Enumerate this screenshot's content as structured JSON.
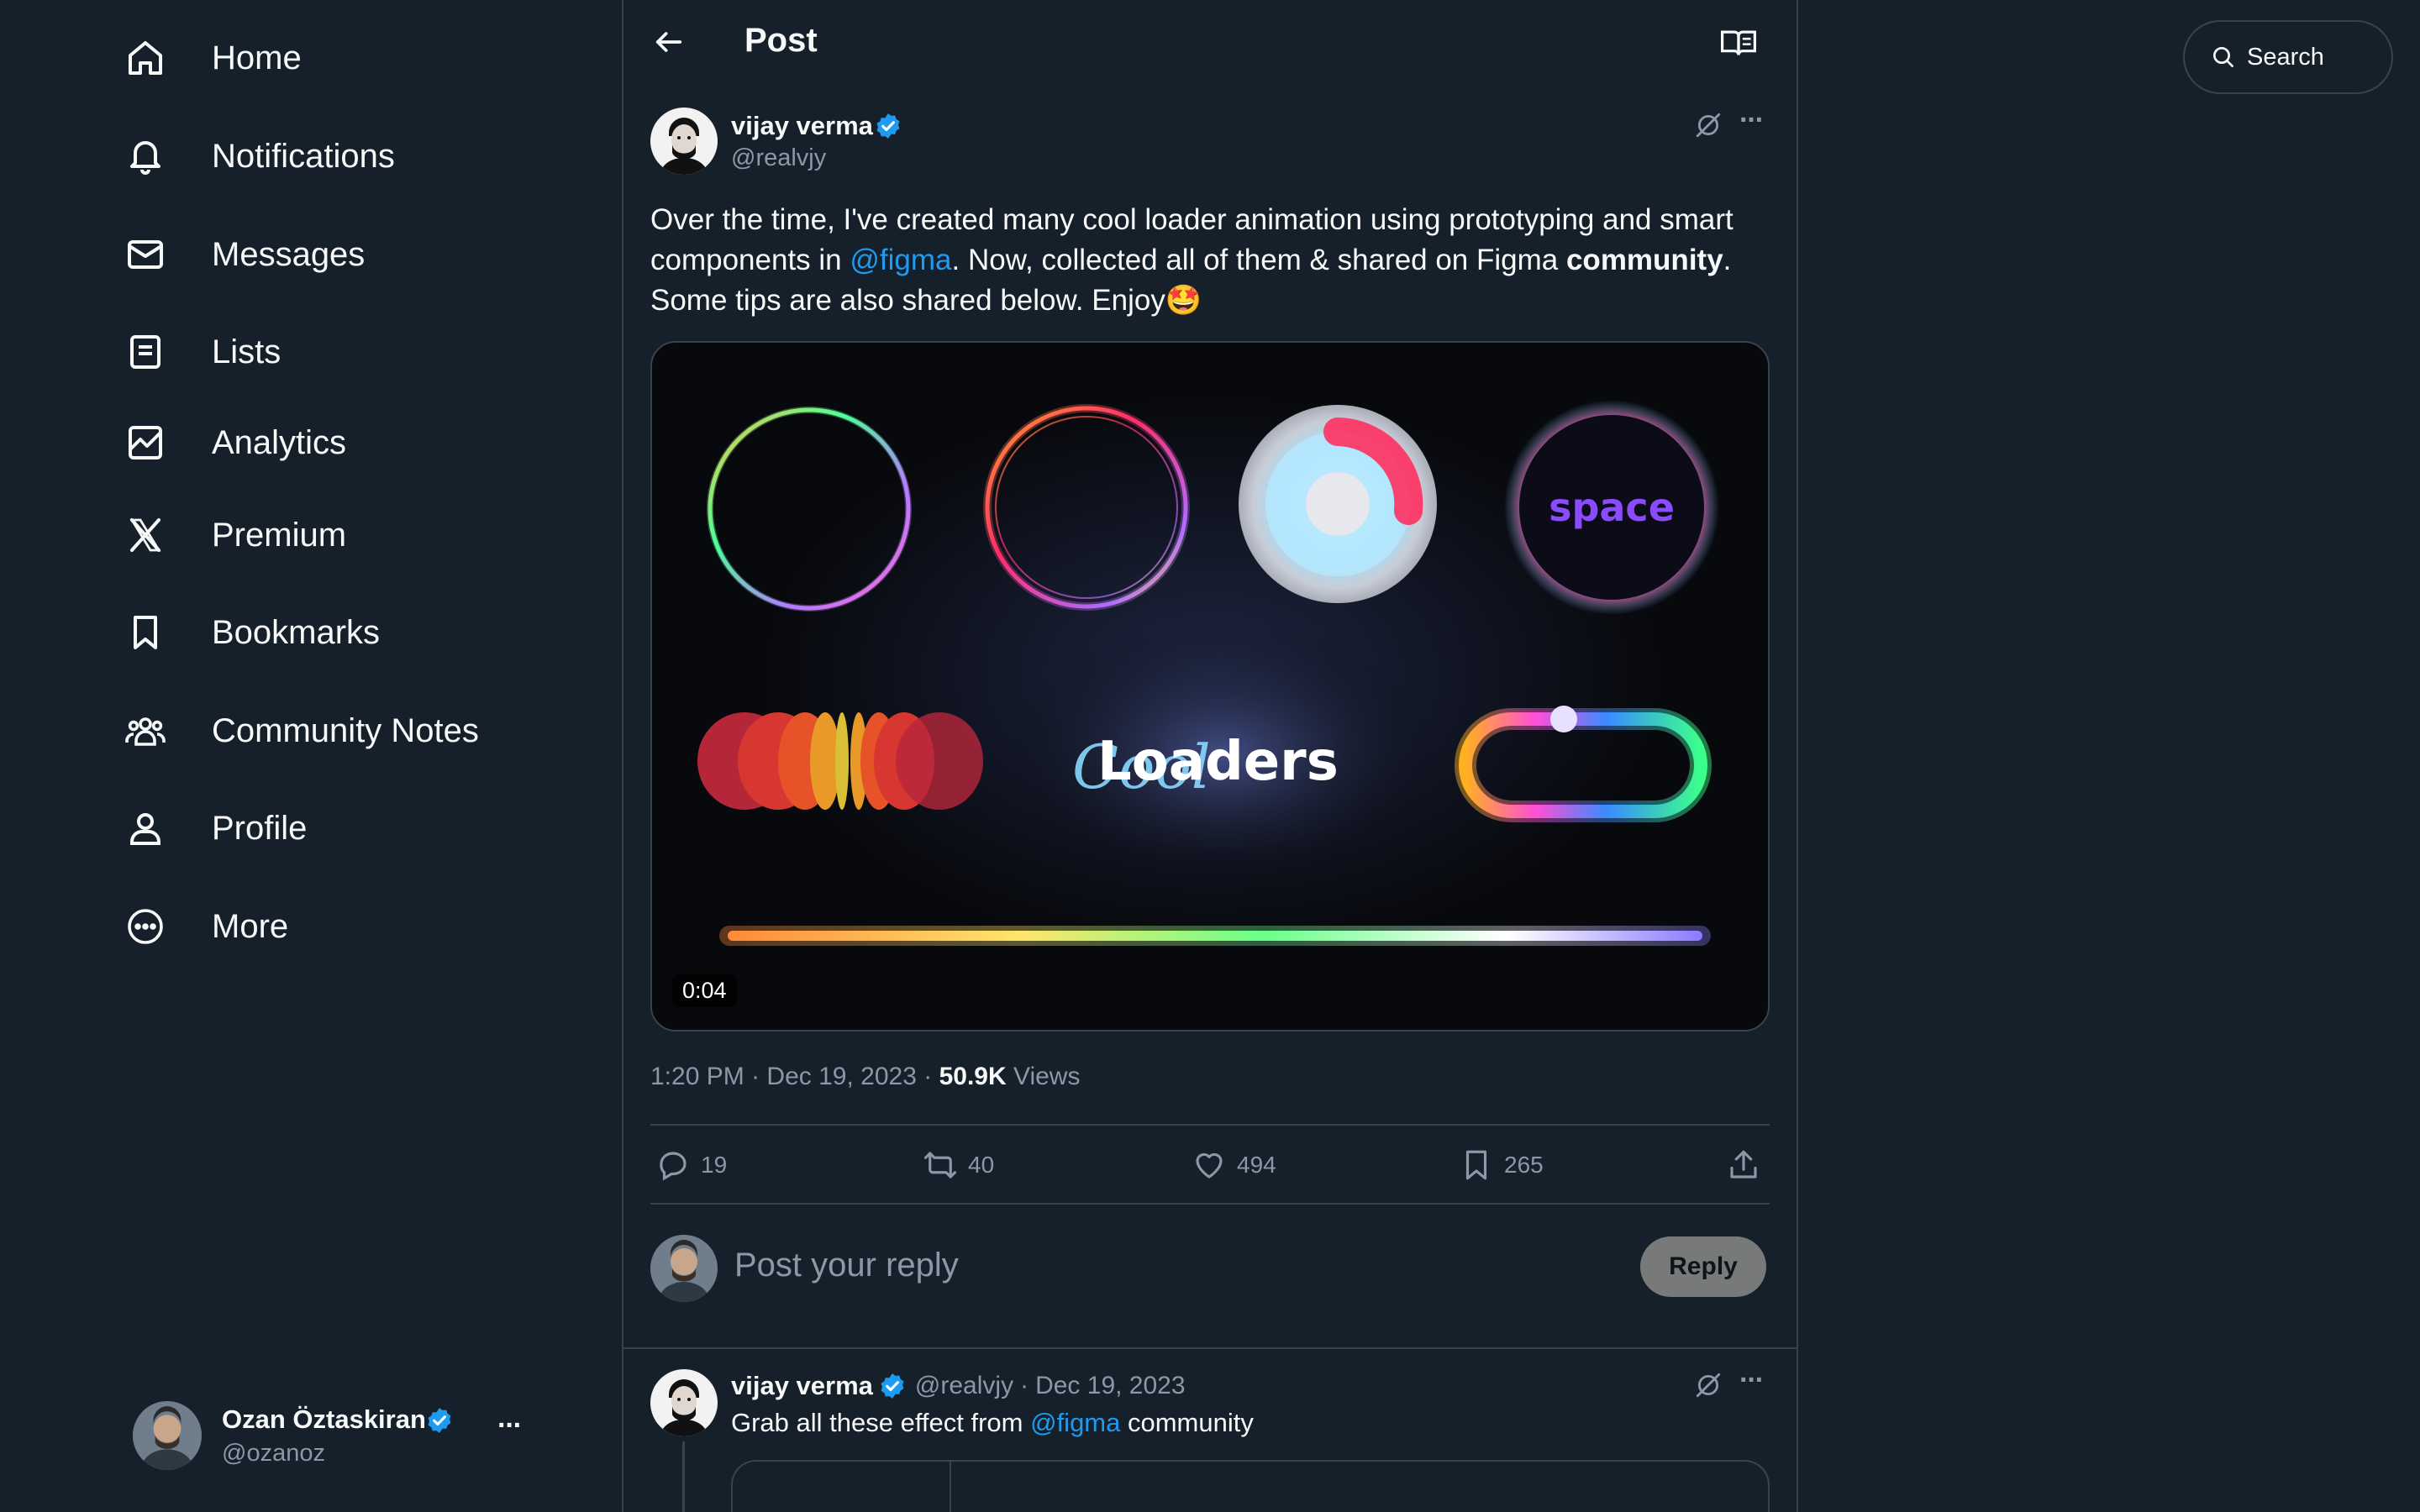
{
  "sidebar": {
    "items": [
      {
        "label": "Home",
        "icon": "home-icon"
      },
      {
        "label": "Notifications",
        "icon": "bell-icon"
      },
      {
        "label": "Messages",
        "icon": "envelope-icon"
      },
      {
        "label": "Lists",
        "icon": "list-icon"
      },
      {
        "label": "Analytics",
        "icon": "analytics-icon"
      },
      {
        "label": "Premium",
        "icon": "x-logo-icon"
      },
      {
        "label": "Bookmarks",
        "icon": "bookmark-icon"
      },
      {
        "label": "Community Notes",
        "icon": "people-icon"
      },
      {
        "label": "Profile",
        "icon": "person-icon"
      },
      {
        "label": "More",
        "icon": "more-circle-icon"
      }
    ],
    "account": {
      "name": "Ozan Öztaskiran",
      "handle": "@ozanoz",
      "more": "···"
    }
  },
  "header": {
    "title": "Post"
  },
  "post": {
    "author": {
      "name": "vijay verma",
      "handle": "@realvjy"
    },
    "text": {
      "line1": "Over the time, I've created many cool loader animation using prototyping and smart",
      "line2_pre": "components in ",
      "mention": "@figma",
      "line2_mid": ". Now, collected all of them & shared on Figma ",
      "line2_bold": "community",
      "line2_end": ".",
      "line3": "Some tips are also shared below. Enjoy🤩"
    },
    "media": {
      "duration": "0:04",
      "space_text": "space",
      "cool_text": "Cool",
      "loaders_text": "Loaders"
    },
    "meta": {
      "time": "1:20 PM",
      "date": "Dec 19, 2023",
      "views": "50.9K",
      "views_label": "Views",
      "sep": "·"
    },
    "actions": {
      "replies": "19",
      "reposts": "40",
      "likes": "494",
      "bookmarks": "265"
    }
  },
  "compose": {
    "placeholder": "Post your reply",
    "button": "Reply"
  },
  "reply": {
    "author": {
      "name": "vijay verma",
      "handle": "@realvjy",
      "date": "Dec 19, 2023",
      "sep": "·"
    },
    "text_pre": "Grab all these effect from ",
    "mention": "@figma",
    "text_post": " community"
  },
  "search": {
    "label": "Search"
  },
  "colors": {
    "background": "#15202b",
    "accent": "#1d9bf0",
    "border": "#38444d",
    "muted": "#8b98a5"
  }
}
